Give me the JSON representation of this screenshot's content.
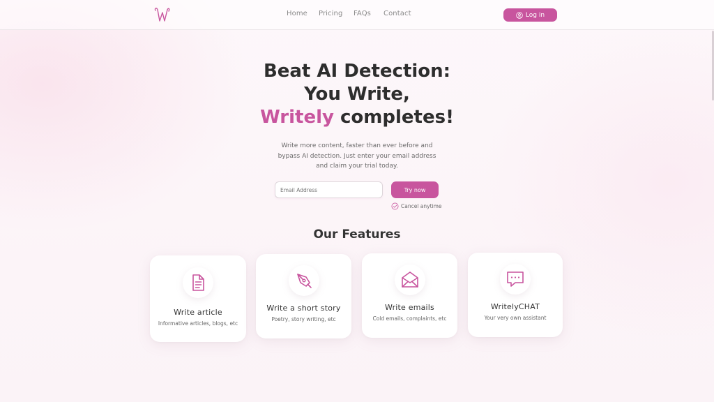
{
  "header": {
    "logo_letter": "W",
    "nav": [
      "Home",
      "Pricing",
      "FAQs",
      "Contact"
    ],
    "login_label": "Log in"
  },
  "hero": {
    "title_line1": "Beat AI Detection:",
    "title_line2": "You Write,",
    "title_brand": "Writely",
    "title_line3_rest": " completes!",
    "subtitle": "Write more content, faster than ever before and bypass AI detection. Just enter your email address and claim your trial today.",
    "email_placeholder": "Email Address",
    "cta_label": "Try now",
    "cancel_note": "Cancel anytime"
  },
  "features": {
    "heading": "Our Features",
    "items": [
      {
        "title": "Write article",
        "desc": "Informative articles, blogs, etc",
        "icon": "document-icon"
      },
      {
        "title": "Write a short story",
        "desc": "Poetry, story writing, etc",
        "icon": "pen-nib-icon"
      },
      {
        "title": "Write emails",
        "desc": "Cold emails, complaints, etc",
        "icon": "envelope-icon"
      },
      {
        "title": "WritelyCHAT",
        "desc": "Your very own assistant",
        "icon": "chat-bubble-icon"
      }
    ]
  },
  "colors": {
    "accent": "#c8559e",
    "text": "#2d2d2d",
    "muted": "#6a6a6a"
  }
}
